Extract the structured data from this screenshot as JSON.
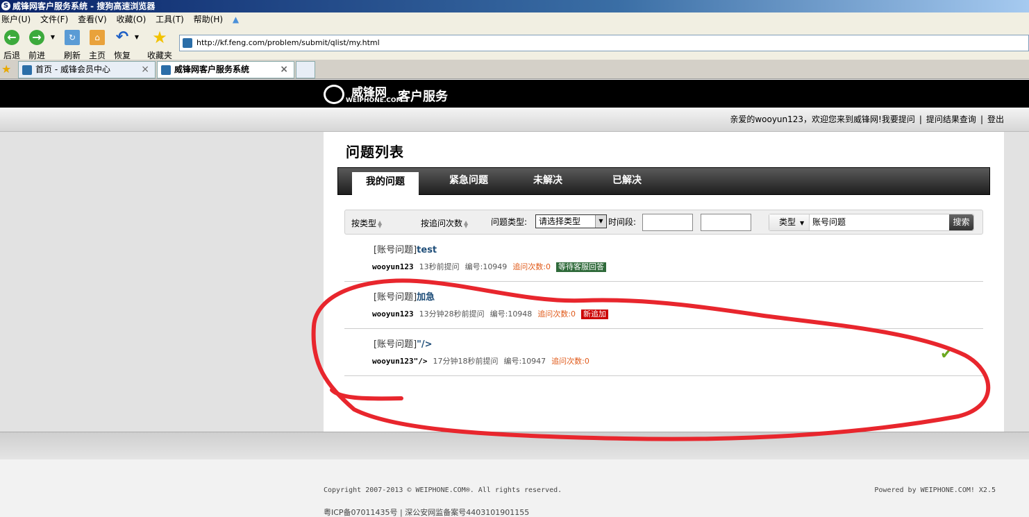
{
  "browser": {
    "window_title": "威锋网客户服务系统 - 搜狗高速浏览器",
    "menu": [
      "账户(U)",
      "文件(F)",
      "查看(V)",
      "收藏(O)",
      "工具(T)",
      "帮助(H)"
    ],
    "toolbar": {
      "back": "后退",
      "forward": "前进",
      "refresh": "刷新",
      "home": "主页",
      "restore": "恢复",
      "favorites": "收藏夹"
    },
    "address": "http://kf.feng.com/problem/submit/qlist/my.html",
    "tabs": [
      {
        "label": "首页 - 威锋会员中心",
        "close": "×"
      },
      {
        "label": "威锋网客户服务系统",
        "close": "×"
      }
    ]
  },
  "site": {
    "brand_cn": "威锋网",
    "brand_en": "WEIPHONE.COM",
    "brand_service": "客户服务",
    "welcome": "亲爱的wooyun123，欢迎您来到威锋网!",
    "links": [
      "我要提问",
      "提问结果查询",
      "登出"
    ],
    "separator": "|"
  },
  "page": {
    "title": "问题列表",
    "nav_tabs": [
      "我的问题",
      "紧急问题",
      "未解决",
      "已解决"
    ],
    "filter": {
      "sort_type": "按类型",
      "sort_count": "按追问次数",
      "type_label": "问题类型:",
      "type_select": "请选择类型",
      "time_label": "时间段:",
      "search_type": "类型",
      "search_value": "账号问题",
      "search_button": "搜索"
    },
    "questions": [
      {
        "tag": "[账号问题]",
        "title": "test",
        "user": "wooyun123",
        "time": "13秒前提问",
        "id": "编号:10949",
        "count": "追问次数:0",
        "badge": "等待客服回答"
      },
      {
        "tag": "[账号问题]",
        "title": "加急",
        "user": "wooyun123",
        "time": "13分钟28秒前提问",
        "id": "编号:10948",
        "count": "追问次数:0",
        "badge": "新追加"
      },
      {
        "tag": "[账号问题]",
        "title": "\"/>",
        "user": "wooyun123\"/>",
        "time": "17分钟18秒前提问",
        "id": "编号:10947",
        "count": "追问次数:0",
        "check": "✔"
      }
    ]
  },
  "footer": {
    "copyright": "Copyright 2007-2013 © WEIPHONE.COM®. All rights reserved.",
    "powered": "Powered by WEIPHONE.COM! X2.5",
    "icp": "粤ICP备07011435号 | 深公安网监备案号4403101901155"
  },
  "colors": {
    "site_header": "#000000",
    "scribble": "#e8262d",
    "badge_waiting": "#2f6a3a",
    "badge_new": "#cc0000"
  }
}
